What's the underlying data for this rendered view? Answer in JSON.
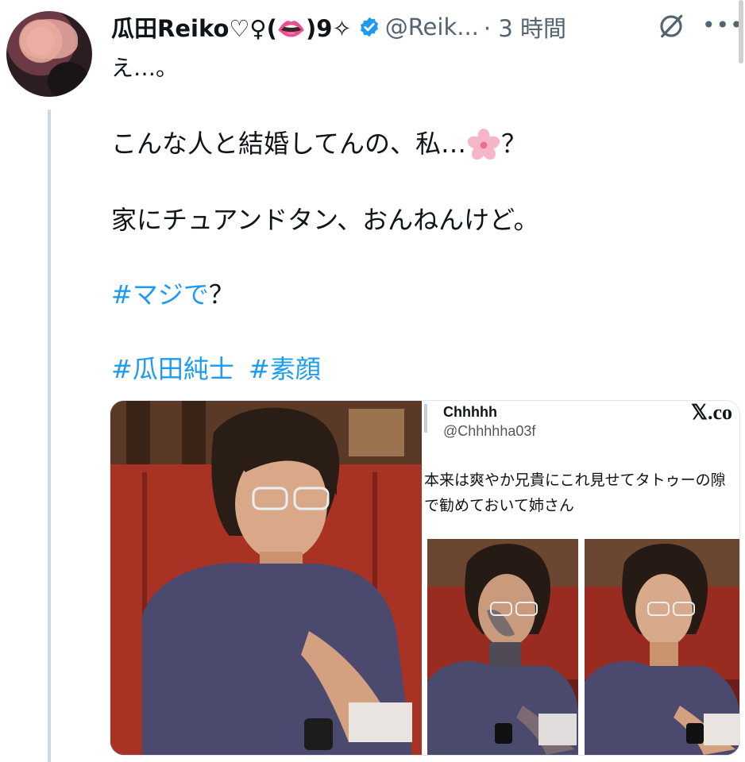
{
  "tweet": {
    "display_name": "瓜田Reiko♡♀(👄)9✧",
    "handle": "@Reik...",
    "time": "· 3 時間",
    "lines": {
      "line1": "え…。",
      "line2": "こんな人と結婚してんの、私…",
      "line2_end": "？",
      "line3": "家にチュアンドタン、おんねんけど。",
      "line4_tag": "#マジで",
      "line4_end": "？",
      "tag1": "#瓜田純士",
      "tag2": "#素顔"
    },
    "icons": {
      "verified": "verified-badge-icon",
      "grok": "grok-icon",
      "more": "more-icon",
      "emoji": "cherry-blossom-icon"
    }
  },
  "quote_card": {
    "name": "Chhhhh",
    "handle": "@Chhhhha03f",
    "logo": "𝕏.co",
    "text_line1": "本来は爽やか兄貴にこれ見せてタトゥーの隙",
    "text_line2": "で勧めておいて姉さん"
  },
  "colors": {
    "accent": "#1d9bf0",
    "muted": "#536471",
    "thread_line": "#cfd9de"
  }
}
